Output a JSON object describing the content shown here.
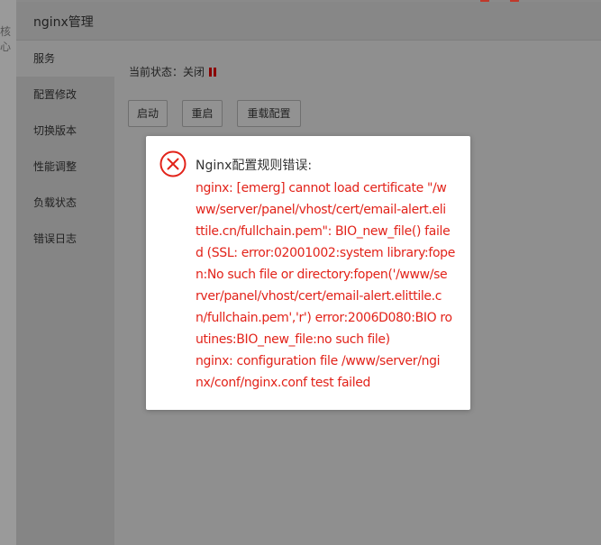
{
  "background": {
    "partial_text": "核心"
  },
  "dialog": {
    "title": "nginx管理"
  },
  "sidebar": {
    "items": [
      {
        "label": "服务",
        "name": "sidebar-item-service",
        "active": true
      },
      {
        "label": "配置修改",
        "name": "sidebar-item-config",
        "active": false
      },
      {
        "label": "切换版本",
        "name": "sidebar-item-version",
        "active": false
      },
      {
        "label": "性能调整",
        "name": "sidebar-item-performance",
        "active": false
      },
      {
        "label": "负载状态",
        "name": "sidebar-item-load",
        "active": false
      },
      {
        "label": "错误日志",
        "name": "sidebar-item-errorlog",
        "active": false
      }
    ]
  },
  "service": {
    "status_label": "当前状态：",
    "status_value": "关闭",
    "status_icon": "pause-icon",
    "buttons": {
      "start": "启动",
      "restart": "重启",
      "reload": "重载配置"
    }
  },
  "alert": {
    "icon": "error-circle-x-icon",
    "title": "Nginx配置规则错误:",
    "lines": [
      "nginx: [emerg] cannot load certificate \"/w",
      "ww/server/panel/vhost/cert/email-alert.eli",
      "ttile.cn/fullchain.pem\": BIO_new_file() faile",
      "d (SSL: error:02001002:system library:fope",
      "n:No such file or directory:fopen('/www/se",
      "rver/panel/vhost/cert/email-alert.elittile.c",
      "n/fullchain.pem','r') error:2006D080:BIO ro",
      "utines:BIO_new_file:no such file)",
      "nginx: configuration file /www/server/ngi",
      "nx/conf/nginx.conf test failed"
    ]
  },
  "colors": {
    "error": "#e2231a",
    "status_off": "#8b0000"
  }
}
